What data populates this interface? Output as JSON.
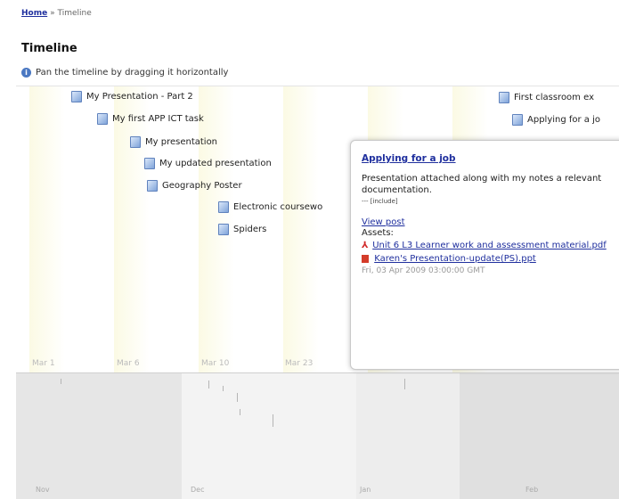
{
  "breadcrumb": {
    "home": "Home",
    "separator": "»",
    "current": "Timeline"
  },
  "page_title": "Timeline",
  "hint": "Pan the timeline by dragging it horizontally",
  "events": [
    {
      "label": "My Presentation - Part 2"
    },
    {
      "label": "My first APP ICT task"
    },
    {
      "label": "My presentation"
    },
    {
      "label": "My updated presentation"
    },
    {
      "label": "Geography Poster"
    },
    {
      "label": "Electronic coursewo"
    },
    {
      "label": "Spiders"
    },
    {
      "label": "First classroom ex"
    },
    {
      "label": "Applying for a jo"
    }
  ],
  "date_labels": [
    "Mar 1",
    "Mar 6",
    "Mar 10",
    "Mar 23"
  ],
  "overview_labels": [
    "Nov",
    "Dec",
    "Jan",
    "Feb"
  ],
  "popup": {
    "title": "Applying for a job",
    "description": "Presentation attached along with my notes a relevant documentation.",
    "tag": "--- [include]",
    "view_post": "View post",
    "assets_label": "Assets:",
    "assets": [
      {
        "icon": "pdf-icon",
        "name": "Unit 6 L3 Learner work and assessment material.pdf"
      },
      {
        "icon": "ppt-icon",
        "name": "Karen's Presentation-update(PS).ppt"
      }
    ],
    "date": "Fri, 03 Apr 2009 03:00:00 GMT"
  },
  "colors": {
    "link": "#1f2f9e",
    "band": "#f8f6ce",
    "overview": "#e3e3e3"
  }
}
